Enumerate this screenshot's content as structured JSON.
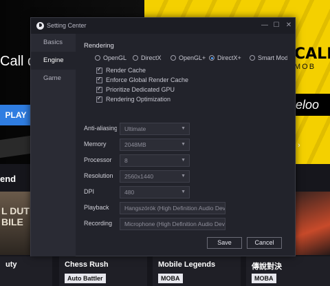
{
  "background": {
    "banner_title": "Call d",
    "play_label": "PLAY",
    "game_logo_line1": "CALL",
    "game_logo_line2": "MOB",
    "game_logo_sub": "eloo",
    "section_title": "end",
    "thumb1_text": "L DUT\nBILE",
    "cards": [
      {
        "name": "uty",
        "tag": ""
      },
      {
        "name": "Chess Rush",
        "tag": "Auto Battler"
      },
      {
        "name": "Mobile Legends",
        "tag": "MOBA"
      },
      {
        "name": "傳說對決",
        "tag": "MOBA"
      }
    ]
  },
  "dialog": {
    "title": "Setting Center",
    "sidebar": [
      {
        "label": "Basics",
        "active": false
      },
      {
        "label": "Engine",
        "active": true
      },
      {
        "label": "Game",
        "active": false
      }
    ],
    "rendering": {
      "section_title": "Rendering",
      "modes": [
        {
          "label": "OpenGL",
          "selected": false
        },
        {
          "label": "DirectX",
          "selected": false
        },
        {
          "label": "OpenGL+",
          "selected": false
        },
        {
          "label": "DirectX+",
          "selected": true
        },
        {
          "label": "Smart Mode",
          "selected": false
        }
      ],
      "options": [
        {
          "label": "Render Cache",
          "checked": true
        },
        {
          "label": "Enforce Global Render Cache",
          "checked": true
        },
        {
          "label": "Prioritize Dedicated GPU",
          "checked": true
        },
        {
          "label": "Rendering Optimization",
          "checked": true
        }
      ]
    },
    "settings": [
      {
        "label": "Anti-aliasing",
        "value": "Ultimate",
        "has_arrow": true
      },
      {
        "label": "Memory",
        "value": "2048MB",
        "has_arrow": true
      },
      {
        "label": "Processor",
        "value": "8",
        "has_arrow": true
      },
      {
        "label": "Resolution",
        "value": "2560x1440",
        "has_arrow": true
      },
      {
        "label": "DPI",
        "value": "480",
        "has_arrow": true
      },
      {
        "label": "Playback",
        "value": "Hangszórók (High Definition Audio Device)",
        "has_arrow": false
      },
      {
        "label": "Recording",
        "value": "Microphone (High Definition Audio Device)",
        "has_arrow": false
      }
    ],
    "buttons": {
      "save": "Save",
      "cancel": "Cancel"
    },
    "titlebar_icons": {
      "minimize": "minimize-icon",
      "maximize": "maximize-icon",
      "close": "close-icon"
    }
  }
}
